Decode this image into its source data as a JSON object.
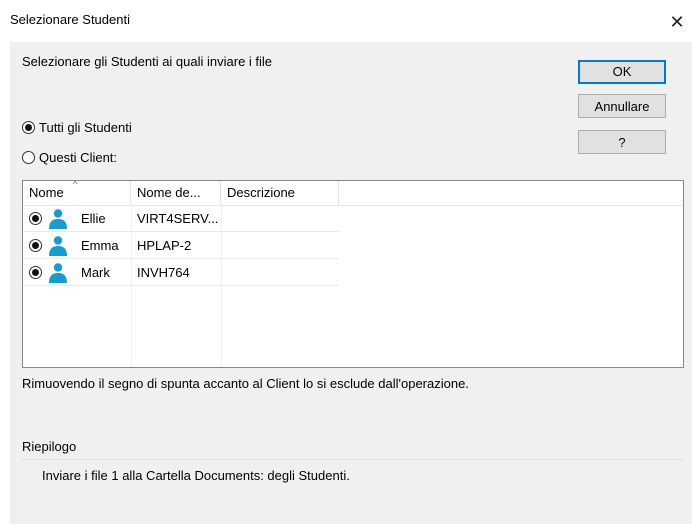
{
  "window": {
    "title": "Selezionare Studenti",
    "close_glyph": "✕"
  },
  "dialog": {
    "description": "Selezionare gli Studenti ai quali inviare i file",
    "buttons": {
      "ok": "OK",
      "cancel": "Annullare",
      "help": "?"
    }
  },
  "radios": {
    "all_students": {
      "label": "Tutti gli Studenti",
      "checked": true
    },
    "these_clients": {
      "label": "Questi Client:",
      "checked": false
    }
  },
  "list": {
    "columns": [
      "Nome",
      "Nome de...",
      "Descrizione"
    ],
    "sort_indicator": "^",
    "rows": [
      {
        "name": "Ellie",
        "machine": "VIRT4SERV...",
        "description": "",
        "checked": true,
        "icon": "student-icon"
      },
      {
        "name": "Emma",
        "machine": "HPLAP-2",
        "description": "",
        "checked": true,
        "icon": "student-icon"
      },
      {
        "name": "Mark",
        "machine": "INVH764",
        "description": "",
        "checked": true,
        "icon": "student-icon"
      }
    ]
  },
  "hint": "Rimuovendo il segno di spunta accanto al Client lo si esclude dall'operazione.",
  "summary": {
    "label": "Riepilogo",
    "text": "Inviare i file 1 alla Cartella Documents: degli Studenti."
  },
  "colors": {
    "accent": "#0078d7",
    "student_icon": "#1a9bd0"
  }
}
